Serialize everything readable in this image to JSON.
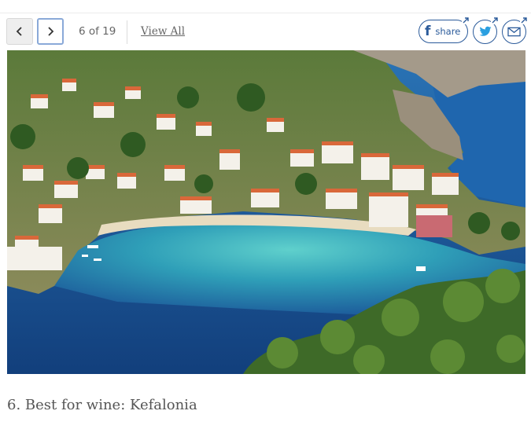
{
  "slideshow": {
    "counter": "6 of 19",
    "view_all_label": "View All"
  },
  "share": {
    "facebook_label": "share",
    "facebook_icon": "facebook-icon",
    "twitter_icon": "twitter-icon",
    "email_icon": "email-icon",
    "brand_color": "#2a5a9a"
  },
  "slide": {
    "caption": "6. Best for wine: Kefalonia"
  },
  "colors": {
    "nav_active_border": "#8aa9d8",
    "sea_deep": "#1f5e9e",
    "sea_shallow": "#3fb8c4"
  }
}
